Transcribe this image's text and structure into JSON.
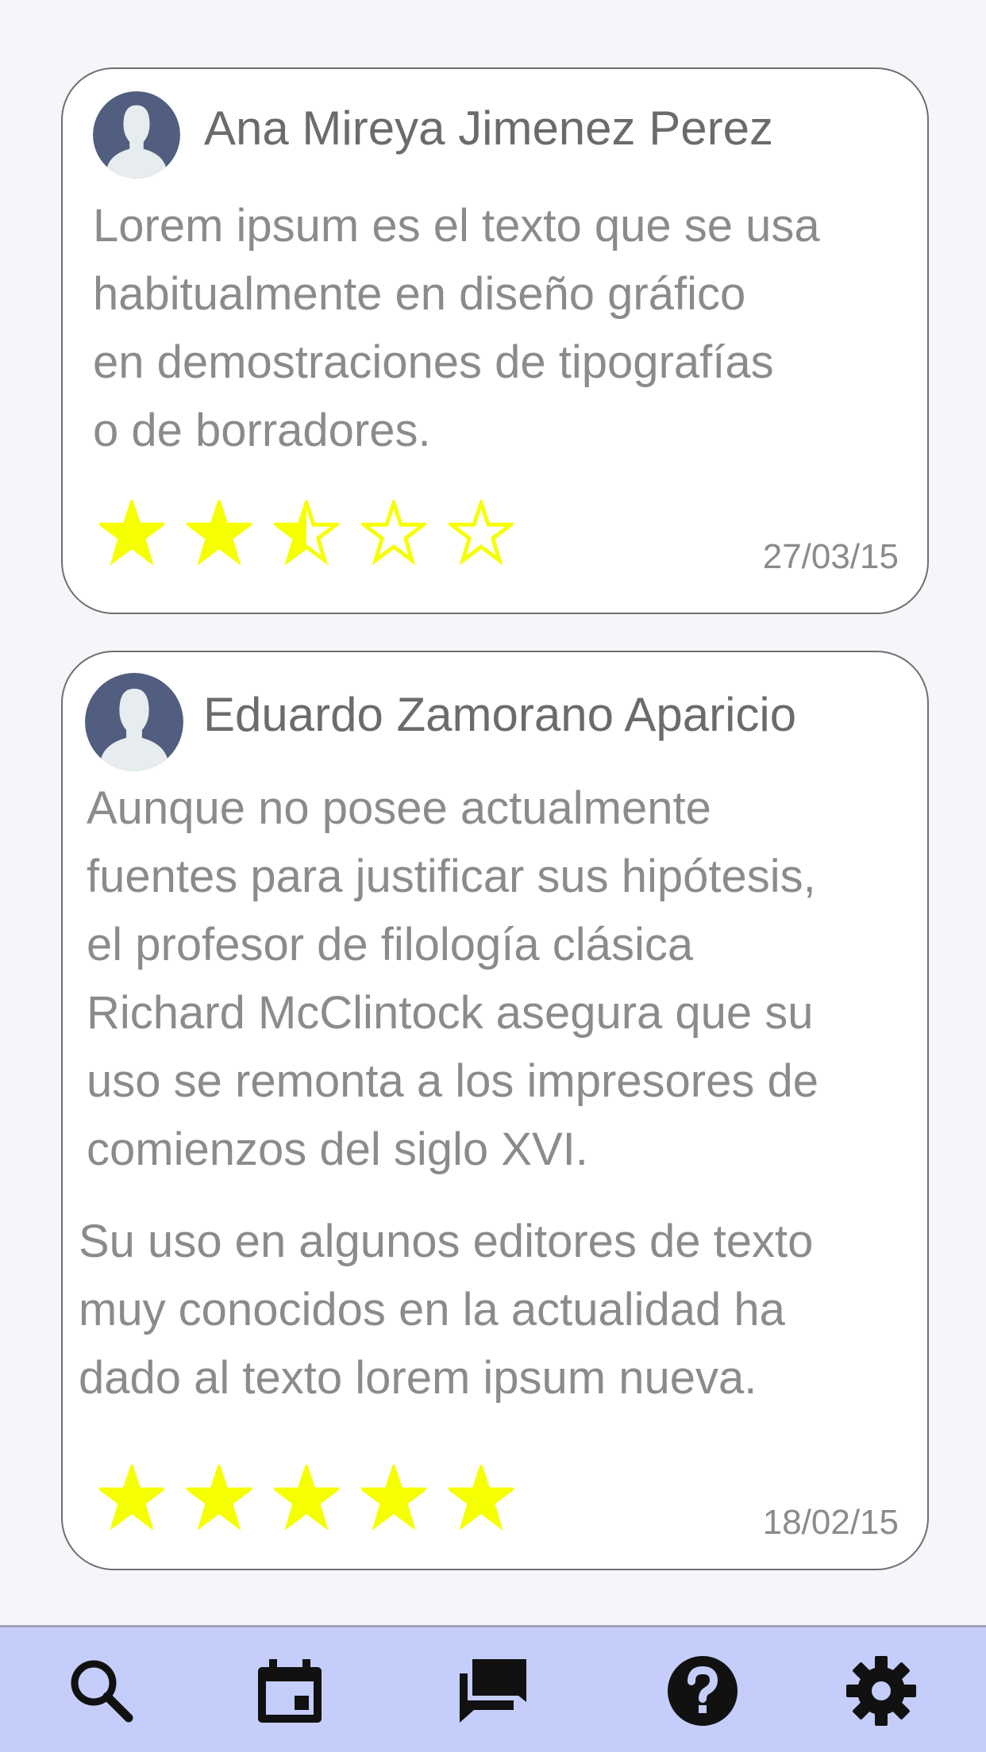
{
  "colors": {
    "star_fill": "#f6ff00",
    "avatar_bg": "#525e80",
    "tabbar_bg": "#c5cdfb"
  },
  "reviews": [
    {
      "author": "Ana Mireya Jimenez Perez",
      "paragraphs": [
        [
          "Lorem ipsum es el texto que se usa",
          "habitualmente en diseño gráfico",
          "en demostraciones de tipografías",
          "o de borradores."
        ]
      ],
      "rating": 2.5,
      "date": "27/03/15"
    },
    {
      "author": "Eduardo Zamorano Aparicio",
      "paragraphs": [
        [
          "Aunque no posee actualmente",
          "fuentes para justificar sus hipótesis,",
          "el profesor de filología clásica",
          "Richard McClintock asegura que su",
          "uso se remonta a los impresores de",
          "comienzos del siglo XVI."
        ],
        [
          "Su uso en algunos editores de texto",
          "muy conocidos en la actualidad ha",
          "dado al texto lorem ipsum nueva."
        ]
      ],
      "rating": 5,
      "date": "18/02/15"
    }
  ],
  "tabbar": {
    "items": [
      {
        "icon": "search-icon"
      },
      {
        "icon": "calendar-icon"
      },
      {
        "icon": "chat-icon"
      },
      {
        "icon": "help-icon"
      },
      {
        "icon": "gear-icon"
      }
    ]
  }
}
